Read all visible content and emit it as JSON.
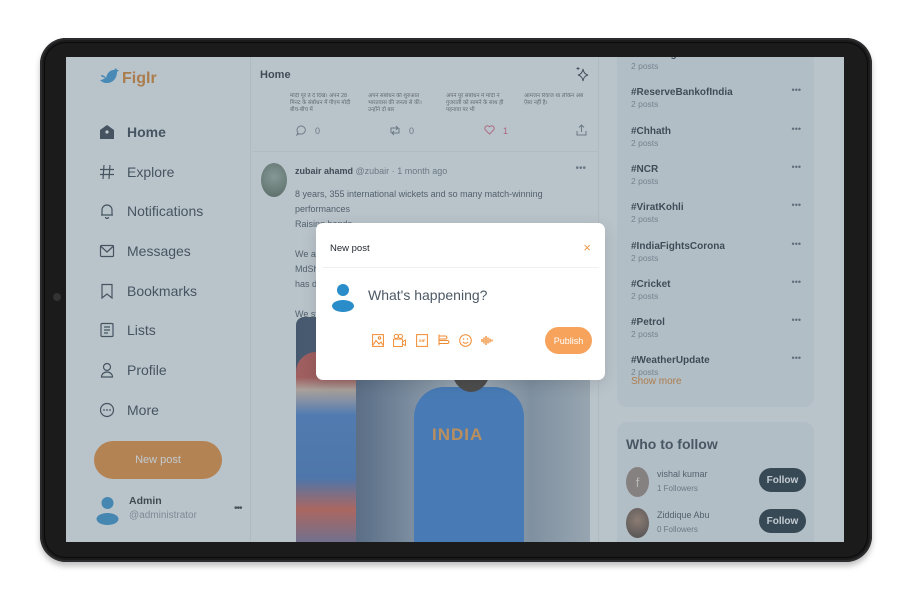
{
  "app": {
    "name": "Figlr",
    "brand_color": "#e8852a"
  },
  "sidebar": {
    "items": [
      {
        "label": "Home",
        "icon": "home-icon",
        "active": true
      },
      {
        "label": "Explore",
        "icon": "hash-icon"
      },
      {
        "label": "Notifications",
        "icon": "bell-icon"
      },
      {
        "label": "Messages",
        "icon": "mail-icon"
      },
      {
        "label": "Bookmarks",
        "icon": "bookmark-icon"
      },
      {
        "label": "Lists",
        "icon": "list-icon"
      },
      {
        "label": "Profile",
        "icon": "user-icon"
      },
      {
        "label": "More",
        "icon": "more-circle-icon"
      }
    ],
    "new_post_label": "New post",
    "user": {
      "name": "Admin",
      "handle": "@administrator",
      "more": "•••"
    }
  },
  "feed": {
    "title": "Home",
    "prev_post": {
      "snippets": [
        "मोदी पूरे ते दे दिखे। अपने 28 मिनट के संबोधन में पीएम मोदी बीच-बीच में",
        "अपने संबोधन की शुरुआत भारतवास की जनता से की। उन्होंने दो बार",
        "अपने पूरे संबोधन में मोदी ने गुजराती को सामने के साथ ही पहनावा पर भी",
        "आमजन रिवाज था लेकिन अब ऐसा नहीं है।"
      ],
      "replies": "0",
      "retweets": "0",
      "likes": "1"
    },
    "post": {
      "author": "zubair ahamd",
      "handle": "@zubair",
      "time": "· 1 month ago",
      "more": "•••",
      "lines": [
        "8 years, 355 international wickets and so many match-winning performances",
        "Raising hands",
        "",
        "We ar",
        "MdSh",
        "has d",
        "",
        "We st"
      ],
      "image_jersey_text": "INDIA"
    }
  },
  "trends": {
    "items": [
      {
        "tag": "#UniteFightCorona",
        "count": "2 posts"
      },
      {
        "tag": "#ReserveBankofIndia",
        "count": "2 posts"
      },
      {
        "tag": "#Chhath",
        "count": "2 posts"
      },
      {
        "tag": "#NCR",
        "count": "2 posts"
      },
      {
        "tag": "#ViratKohli",
        "count": "2 posts"
      },
      {
        "tag": "#IndiaFightsCorona",
        "count": "2 posts"
      },
      {
        "tag": "#Cricket",
        "count": "2 posts"
      },
      {
        "tag": "#Petrol",
        "count": "2 posts"
      },
      {
        "tag": "#WeatherUpdate",
        "count": "2 posts"
      }
    ],
    "more": "•••",
    "show_more": "Show more"
  },
  "who_to_follow": {
    "title": "Who to follow",
    "users": [
      {
        "name": "vishal kumar",
        "followers": "1 Followers",
        "button": "Follow",
        "avatar_letter": "f"
      },
      {
        "name": "Ziddique Abu",
        "followers": "0 Followers",
        "button": "Follow"
      }
    ]
  },
  "modal": {
    "title": "New post",
    "close": "×",
    "placeholder": "What's happening?",
    "tools": [
      "image-icon",
      "video-icon",
      "gif-icon",
      "poll-icon",
      "emoji-icon",
      "audio-icon"
    ],
    "gif_label": "GIF",
    "publish_label": "Publish"
  }
}
